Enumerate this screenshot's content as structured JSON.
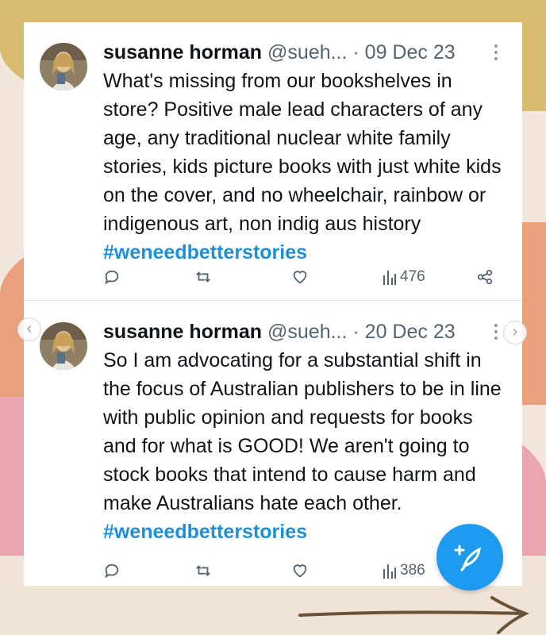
{
  "tweets": [
    {
      "name": "susanne horman",
      "handle": "@sueh...",
      "date": "· 09 Dec 23",
      "text": "What's missing from our bookshelves in store? Positive male lead characters of any age, any traditional nuclear white family stories, kids picture books with just white kids on the cover, and no wheelchair, rainbow or indigenous art, non indig aus history",
      "hashtag": "#weneedbetterstories",
      "views": "476"
    },
    {
      "name": "susanne horman",
      "handle": "@sueh...",
      "date": "· 20 Dec 23",
      "text": "So I am advocating for a substantial shift in the focus of Australian publishers to be in line with public opinion and requests for books and for what is GOOD! We aren't going to stock books that intend to cause harm and make Australians hate each other.",
      "hashtag": "#weneedbetterstories",
      "views": "386"
    }
  ],
  "icons": {
    "reply": "reply-icon",
    "retweet": "retweet-icon",
    "like": "like-icon",
    "views": "views-icon",
    "share": "share-icon",
    "more": "more-icon",
    "compose": "compose-icon"
  },
  "colors": {
    "accent": "#1d9bf0",
    "hashtag": "#1d8fd8",
    "muted": "#536471",
    "text": "#0f1419",
    "band_gold": "#d9bb6f",
    "band_orange": "#eaa07c",
    "band_pink": "#eaa5b0",
    "band_cream": "#f3e6dc"
  }
}
